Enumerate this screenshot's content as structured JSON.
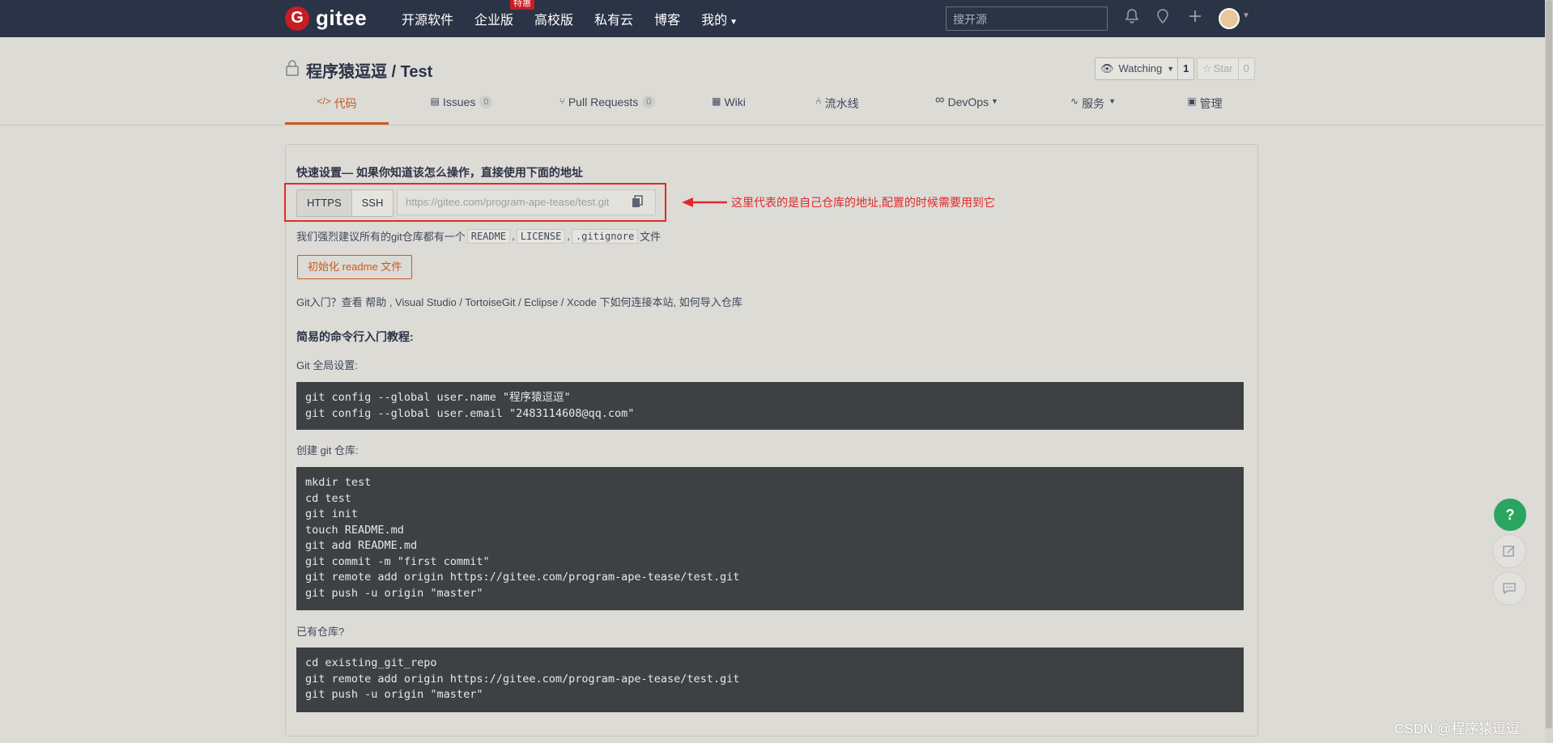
{
  "header": {
    "logo_text": "gitee",
    "logo_letter": "G",
    "nav": [
      {
        "label": "开源软件"
      },
      {
        "label": "企业版",
        "tag": "特惠"
      },
      {
        "label": "高校版"
      },
      {
        "label": "私有云"
      },
      {
        "label": "博客"
      },
      {
        "label": "我的"
      }
    ],
    "search_placeholder": "搜开源"
  },
  "repo": {
    "title": "程序猿逗逗 / Test",
    "watch_label": "Watching",
    "watch_count": "1",
    "star_label": "Star",
    "star_count": "0",
    "tabs": [
      {
        "label": "代码"
      },
      {
        "label": "Issues",
        "badge": "0"
      },
      {
        "label": "Pull Requests",
        "badge": "0"
      },
      {
        "label": "Wiki"
      },
      {
        "label": "流水线"
      },
      {
        "label": "DevOps"
      },
      {
        "label": "服务"
      },
      {
        "label": "管理"
      }
    ]
  },
  "quick_setup": {
    "title": "快速设置— 如果你知道该怎么操作，直接使用下面的地址",
    "protocols": [
      "HTTPS",
      "SSH"
    ],
    "url": "https://gitee.com/program-ape-tease/test.git",
    "annotation": "这里代表的是自己仓库的地址,配置的时候需要用到它",
    "recommend_prefix": "我们强烈建议所有的git仓库都有一个",
    "recommend_files": [
      "README",
      "LICENSE",
      ".gitignore"
    ],
    "recommend_suffix": "文件",
    "init_button": "初始化 readme 文件",
    "help_text": "Git入门？查看 帮助 , Visual Studio / TortoiseGit / Eclipse / Xcode 下如何连接本站, 如何导入仓库"
  },
  "tutorial": {
    "title": "简易的命令行入门教程:",
    "global_label": "Git 全局设置:",
    "global_code": "git config --global user.name \"程序猿逗逗\"\ngit config --global user.email \"2483114608@qq.com\"",
    "create_label": "创建 git 仓库:",
    "create_code": "mkdir test\ncd test\ngit init\ntouch README.md\ngit add README.md\ngit commit -m \"first commit\"\ngit remote add origin https://gitee.com/program-ape-tease/test.git\ngit push -u origin \"master\"",
    "existing_label": "已有仓库?",
    "existing_code": "cd existing_git_repo\ngit remote add origin https://gitee.com/program-ape-tease/test.git\ngit push -u origin \"master\""
  },
  "fab": {
    "help": "?"
  },
  "watermark": "CSDN @程序猿逗逗",
  "colors": {
    "accent": "#c75b1c",
    "topbar": "#2b3346",
    "annotation": "#e02a2a",
    "fab_help": "#2aa55f"
  }
}
